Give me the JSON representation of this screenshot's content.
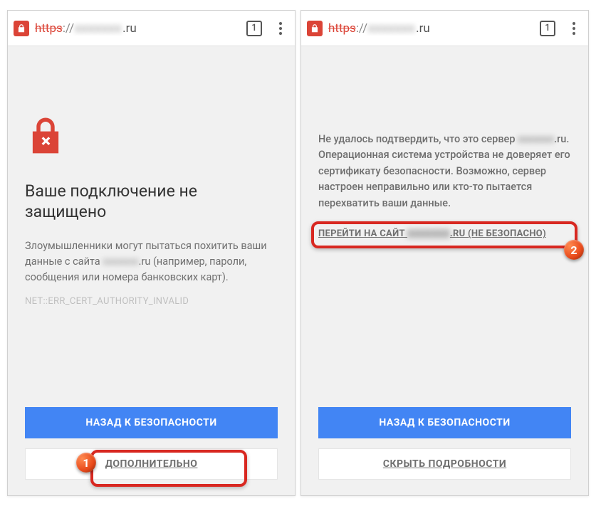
{
  "addressbar": {
    "protocol": "https",
    "separator": "://",
    "domain_hidden": "xxxxxxx",
    "tld": ".ru",
    "tab_count": "1"
  },
  "left": {
    "heading": "Ваше подключение не защищено",
    "body_pre": "Злоумышленники могут пытаться похитить ваши данные с сайта ",
    "body_domain": "xxxxxxx",
    "body_post": ".ru (например, пароли, сообщения или номера банковских карт).",
    "error_code": "NET::ERR_CERT_AUTHORITY_INVALID",
    "back_button": "НАЗАД К БЕЗОПАСНОСТИ",
    "advanced_button": "ДОПОЛНИТЕЛЬНО"
  },
  "right": {
    "para_pre": "Не удалось подтвердить, что это сервер ",
    "para_domain": "xxxxxxx",
    "para_post": ".ru. Операционная система устройства не доверяет его сертификату безопасности. Возможно, сервер настроен неправильно или кто-то пытается перехватить ваши данные.",
    "proceed_pre": "ПЕРЕЙТИ НА САЙТ ",
    "proceed_domain": "XXXXXXX",
    "proceed_post": ".RU (НЕ БЕЗОПАСНО)",
    "back_button": "НАЗАД К БЕЗОПАСНОСТИ",
    "hide_button": "СКРЫТЬ ПОДРОБНОСТИ"
  },
  "markers": {
    "one": "1",
    "two": "2"
  }
}
